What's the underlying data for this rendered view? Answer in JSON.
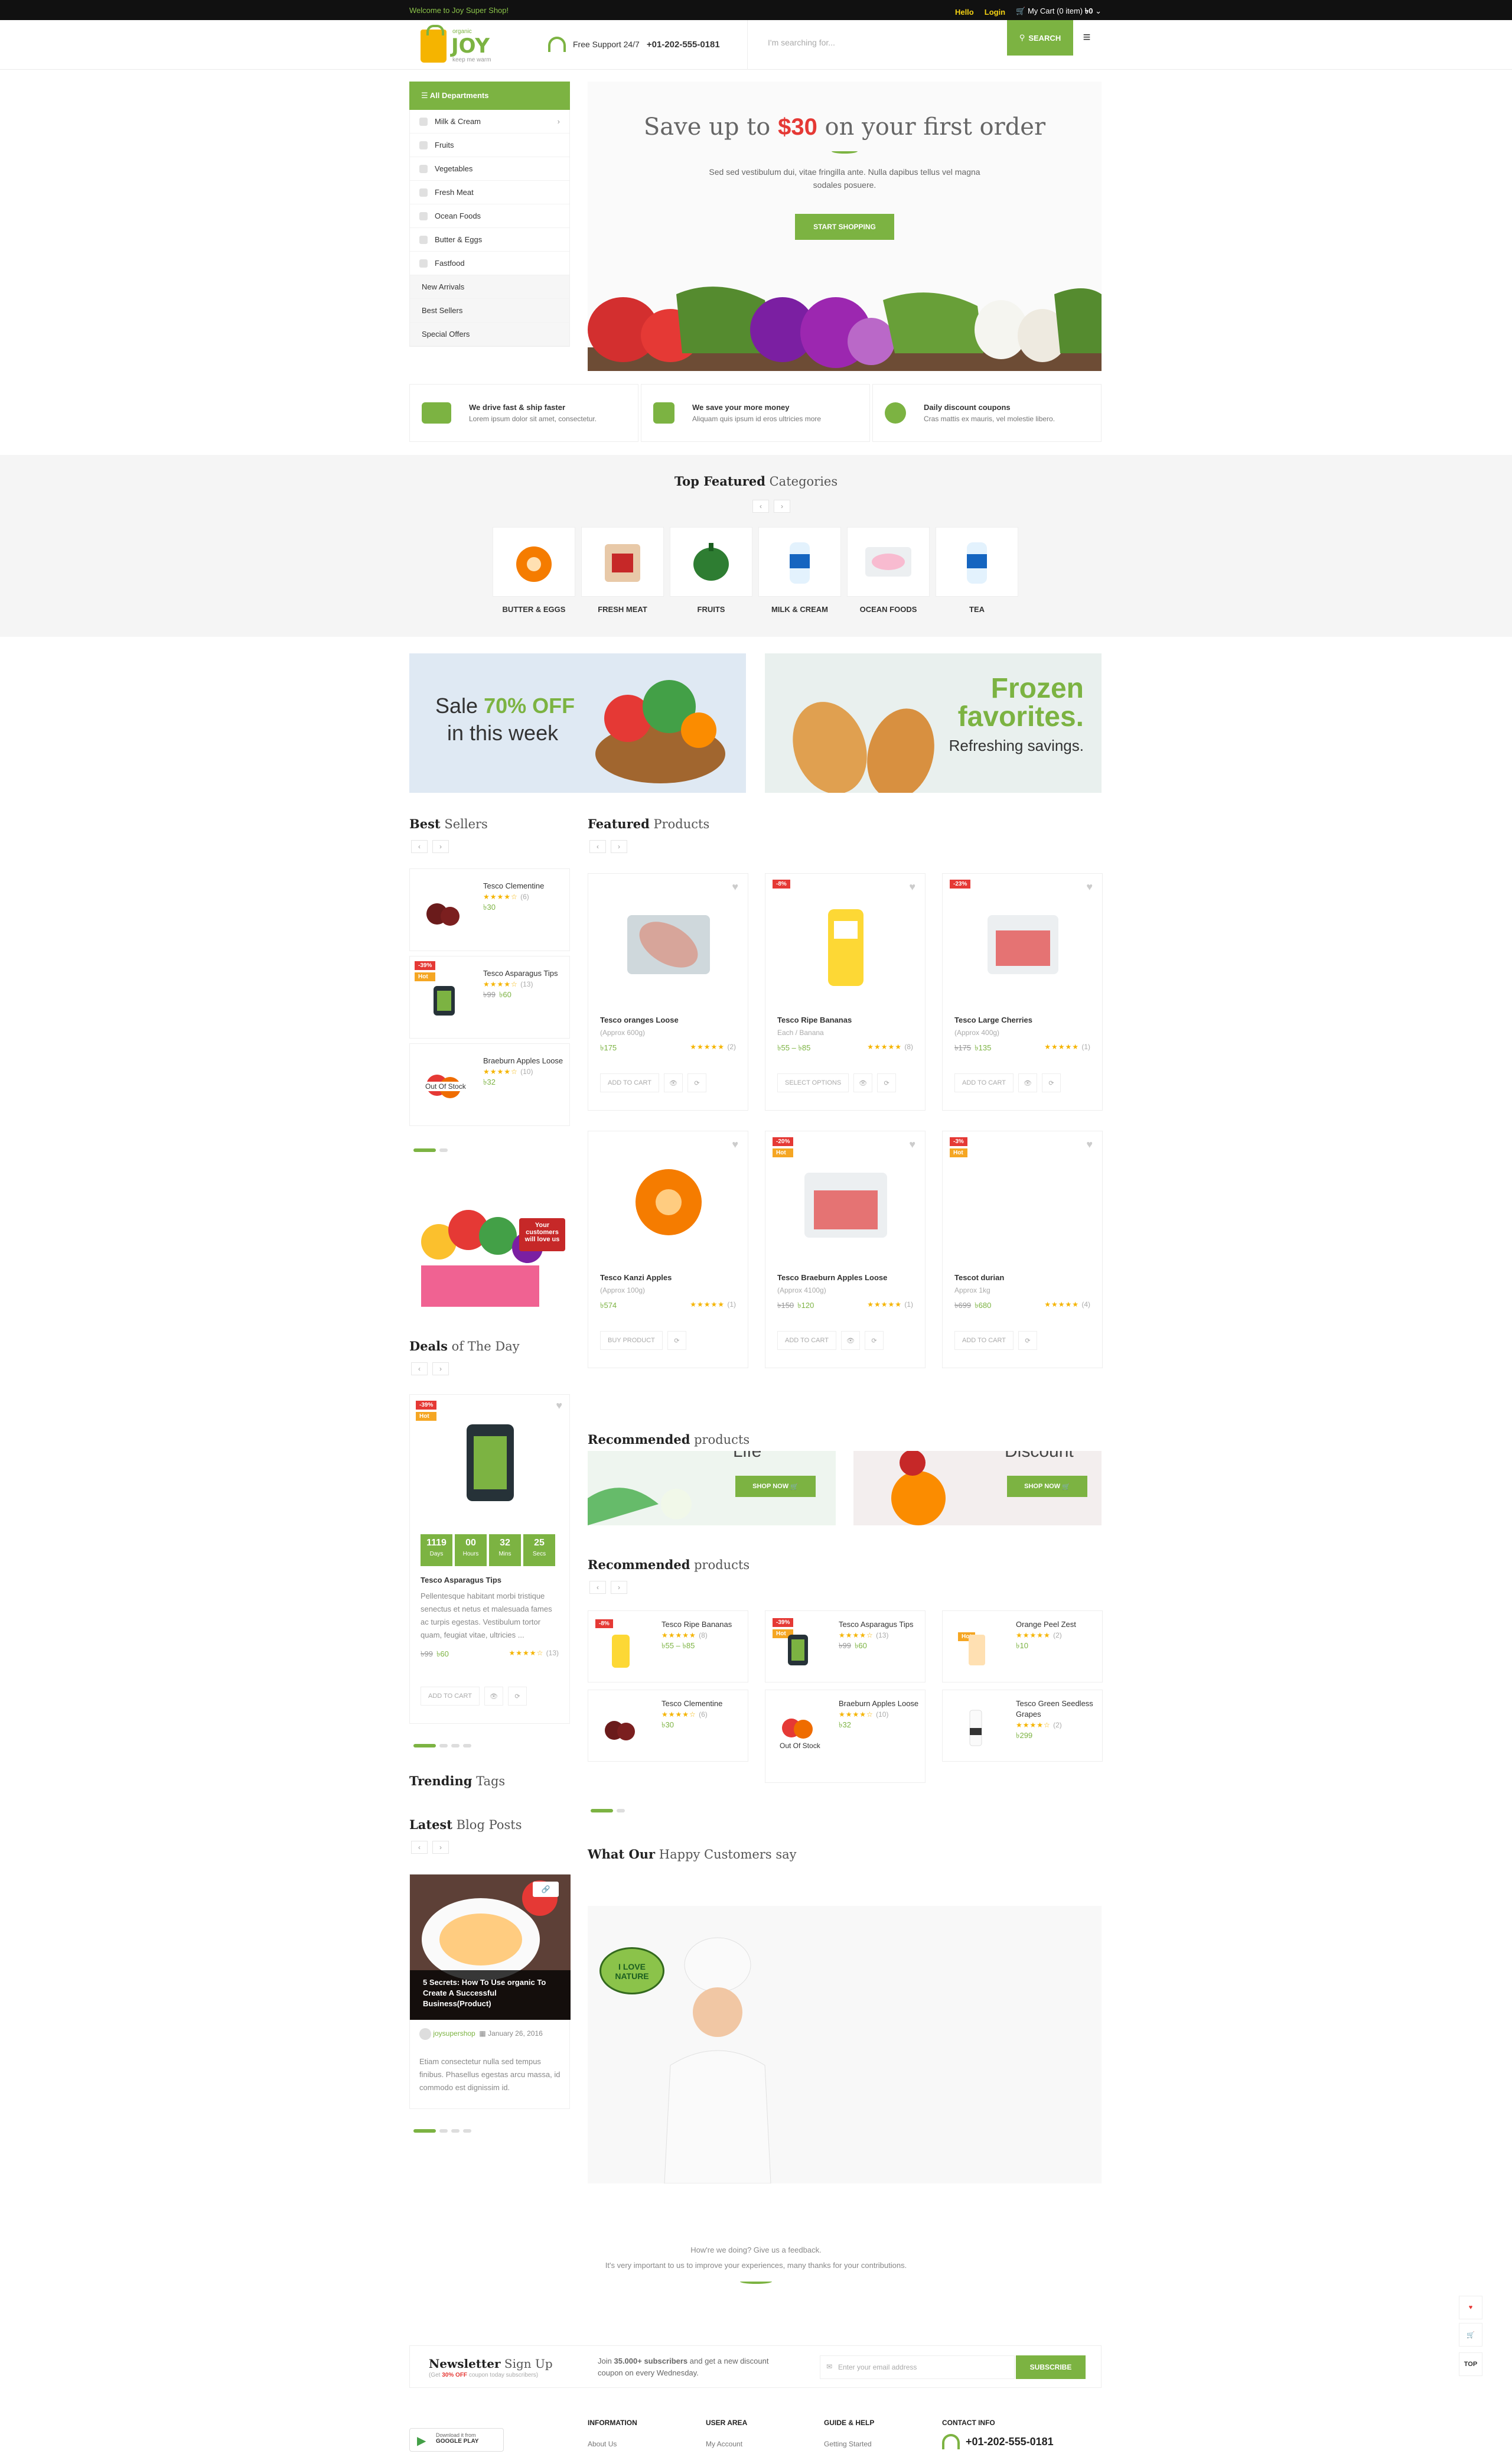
{
  "topbar": {
    "welcome": "Welcome to Joy Super Shop!",
    "hello": "Hello",
    "login": "Login",
    "cart": "My Cart (0 item)",
    "cart_total": "৳0"
  },
  "header": {
    "logo_name": "JOY",
    "logo_small": "organic",
    "logo_tag": "keep me warm",
    "support_label": "Free Support 24/7",
    "support_phone": "+01-202-555-0181",
    "search_placeholder": "I'm searching for...",
    "search_button": "SEARCH"
  },
  "departments": {
    "title": "All Departments",
    "items": [
      "Milk & Cream",
      "Fruits",
      "Vegetables",
      "Fresh Meat",
      "Ocean Foods",
      "Butter & Eggs",
      "Fastfood"
    ],
    "extra": [
      "New Arrivals",
      "Best Sellers",
      "Special Offers"
    ]
  },
  "hero": {
    "title_pre": "Save up to",
    "title_amount": "$30",
    "title_post": "on your first order",
    "text": "Sed sed vestibulum dui, vitae fringilla ante. Nulla dapibus tellus vel magna sodales posuere.",
    "button": "START SHOPPING"
  },
  "features": [
    {
      "title": "We drive fast & ship faster",
      "text": "Lorem ipsum dolor sit amet, consectetur."
    },
    {
      "title": "We save your more money",
      "text": "Aliquam quis ipsum id eros ultricies more"
    },
    {
      "title": "Daily discount coupons",
      "text": "Cras mattis ex mauris, vel molestie libero."
    }
  ],
  "categories": {
    "title_bold": "Top Featured",
    "title_rest": "Categories",
    "items": [
      "BUTTER & EGGS",
      "FRESH MEAT",
      "FRUITS",
      "MILK & CREAM",
      "OCEAN FOODS",
      "TEA"
    ]
  },
  "banners": {
    "sale_line1_pre": "Sale",
    "sale_pct": "70% OFF",
    "sale_line2": "in this week",
    "frozen1": "Frozen",
    "frozen2": "favorites.",
    "frozen3": "Refreshing savings."
  },
  "best_sellers": {
    "title_bold": "Best",
    "title_rest": "Sellers",
    "items": [
      {
        "name": "Tesco Clementine",
        "rating_count": "(6)",
        "price": "৳30",
        "old_price": "",
        "badges": [],
        "stock": ""
      },
      {
        "name": "Tesco Asparagus Tips",
        "rating_count": "(13)",
        "price": "৳60",
        "old_price": "৳99",
        "badges": [
          "-39%",
          "Hot"
        ],
        "stock": ""
      },
      {
        "name": "Braeburn Apples Loose",
        "rating_count": "(10)",
        "price": "৳32",
        "old_price": "",
        "badges": [],
        "stock": "Out Of Stock"
      }
    ]
  },
  "promo": {
    "text": "Your customers will love us"
  },
  "featured": {
    "title_bold": "Featured",
    "title_rest": "Products",
    "items": [
      {
        "name": "Tesco oranges Loose",
        "sub": "(Approx 600g)",
        "price": "৳175",
        "old_price": "",
        "rating_count": "(2)",
        "badges": [],
        "action": "ADD TO CART"
      },
      {
        "name": "Tesco Ripe Bananas",
        "sub": "Each / Banana",
        "price": "৳55 – ৳85",
        "old_price": "",
        "rating_count": "(8)",
        "badges": [
          "-8%"
        ],
        "action": "SELECT OPTIONS"
      },
      {
        "name": "Tesco Large Cherries",
        "sub": "(Approx 400g)",
        "price": "৳135",
        "old_price": "৳175",
        "rating_count": "(1)",
        "badges": [
          "-23%"
        ],
        "action": "ADD TO CART"
      },
      {
        "name": "Tesco Kanzi Apples",
        "sub": "(Approx 100g)",
        "price": "৳574",
        "old_price": "",
        "rating_count": "(1)",
        "badges": [],
        "action": "BUY PRODUCT"
      },
      {
        "name": "Tesco Braeburn Apples Loose",
        "sub": "(Approx 4100g)",
        "price": "৳120",
        "old_price": "৳150",
        "rating_count": "(1)",
        "badges": [
          "-20%",
          "Hot"
        ],
        "action": "ADD TO CART"
      },
      {
        "name": "Tescot durian",
        "sub": "Approx 1kg",
        "price": "৳680",
        "old_price": "৳699",
        "rating_count": "(4)",
        "badges": [
          "-3%",
          "Hot"
        ],
        "action": "ADD TO CART"
      }
    ]
  },
  "deals": {
    "title_bold": "Deals",
    "title_rest": "of The Day",
    "badges": [
      "-39%",
      "Hot"
    ],
    "countdown": [
      {
        "v": "1119",
        "l": "Days"
      },
      {
        "v": "00",
        "l": "Hours"
      },
      {
        "v": "32",
        "l": "Mins"
      },
      {
        "v": "25",
        "l": "Secs"
      }
    ],
    "name": "Tesco Asparagus Tips",
    "desc": "Pellentesque habitant morbi tristique senectus et netus et malesuada fames ac turpis egestas. Vestibulum tortor quam, feugiat vitae, ultricies ...",
    "old_price": "৳99",
    "price": "৳60",
    "rating_count": "(13)",
    "action": "ADD TO CART"
  },
  "recommended_banners": {
    "title_bold": "Recommended",
    "title_rest": "products",
    "items": [
      {
        "word": "Life",
        "button": "SHOP NOW"
      },
      {
        "word": "Discount",
        "button": "SHOP NOW"
      }
    ]
  },
  "recommended": {
    "title_bold": "Recommended",
    "title_rest": "products",
    "items": [
      {
        "name": "Tesco Ripe Bananas",
        "rating_count": "(8)",
        "price": "৳55 – ৳85",
        "old_price": "",
        "badges": [
          "-8%"
        ],
        "stock": ""
      },
      {
        "name": "Tesco Asparagus Tips",
        "rating_count": "(13)",
        "price": "৳60",
        "old_price": "৳99",
        "badges": [
          "-39%",
          "Hot"
        ],
        "stock": ""
      },
      {
        "name": "Orange Peel Zest",
        "rating_count": "(2)",
        "price": "৳10",
        "old_price": "",
        "badges": [
          "Hot"
        ],
        "stock": ""
      },
      {
        "name": "Tesco Clementine",
        "rating_count": "(6)",
        "price": "৳30",
        "old_price": "",
        "badges": [],
        "stock": ""
      },
      {
        "name": "Braeburn Apples Loose",
        "rating_count": "(10)",
        "price": "৳32",
        "old_price": "",
        "badges": [],
        "stock": "Out Of Stock"
      },
      {
        "name": "Tesco Green Seedless Grapes",
        "rating_count": "(2)",
        "price": "৳299",
        "old_price": "",
        "badges": [],
        "stock": ""
      }
    ]
  },
  "trending": {
    "title_bold": "Trending",
    "title_rest": "Tags"
  },
  "blog": {
    "title_bold": "Latest",
    "title_rest": "Blog Posts",
    "post_title": "5 Secrets: How To Use organic To Create A Successful Business(Product)",
    "author": "joysupershop",
    "date": "January 26, 2016",
    "text": "Etiam consectetur nulla sed tempus finibus. Phasellus egestas arcu massa, id commodo est dignissim id."
  },
  "happy": {
    "title_bold": "What Our",
    "title_rest": "Happy Customers say",
    "sign": "I LOVE NATURE"
  },
  "feedback": {
    "line1": "How're we doing? Give us a feedback.",
    "line2": "It's very important to us to improve your experiences, many thanks for your contributions."
  },
  "newsletter": {
    "title_bold": "Newsletter",
    "title_rest": "Sign Up",
    "sub_pre": "Get",
    "sub_pct": "30% OFF",
    "sub_post": "coupon today subscribers",
    "desc_pre": "Join",
    "desc_count": "35.000+ subscribers",
    "desc_post": "and get a new discount coupon on every Wednesday.",
    "placeholder": "Enter your email address",
    "button": "SUBSCRIBE"
  },
  "footer": {
    "app_line1": "Download it from",
    "app_line2": "GOOGLE PLAY",
    "cols": [
      {
        "title": "INFORMATION",
        "item": "About Us"
      },
      {
        "title": "USER AREA",
        "item": "My Account"
      },
      {
        "title": "GUIDE & HELP",
        "item": "Getting Started"
      }
    ],
    "contact_title": "CONTACT INFO",
    "contact_phone": "+01-202-555-0181"
  },
  "side": {
    "top": "TOP"
  },
  "colors": {
    "accent": "#7cb342",
    "sale": "#e53935",
    "hot": "#f5a623",
    "star": "#f5b400"
  }
}
